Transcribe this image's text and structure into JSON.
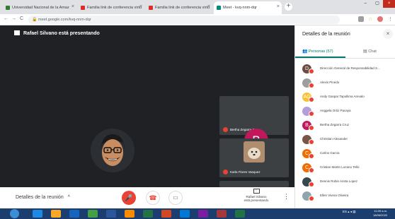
{
  "browser": {
    "tabs": [
      {
        "label": "Universidad Nacional de la Amaz"
      },
      {
        "label": "Familia link de conferencia virtu"
      },
      {
        "label": "Familia link de conferencia virtu"
      },
      {
        "label": "Meet - kvq-nnm-dqr"
      }
    ],
    "new_tab": "+",
    "url": "meet.google.com/kvq-nnm-dqr"
  },
  "meeting": {
    "presenter_banner": "Rafael Silvano está presentando",
    "tiles": [
      {
        "name": "Bertha Zegarra Cruz",
        "avatar_letter": "B",
        "avatar_color": "#c2185b"
      },
      {
        "name": "Karla Flores Vasquez"
      }
    ]
  },
  "controls": {
    "meeting_details": "Detalles de la reunión",
    "chevron": "^",
    "present_label_line1": "Rafael Silvano",
    "present_label_line2": "está presentando",
    "more": "⋮"
  },
  "panel": {
    "title": "Detalles de la reunión",
    "close": "×",
    "tab_people": "Personas (57)",
    "tab_chat": "Chat",
    "people": [
      {
        "name": "Dirección General de Responsabilidad S...",
        "initial": "D",
        "color": "#6d4c41"
      },
      {
        "name": "Alexis Pinedo",
        "initial": "",
        "color": "#9e9e9e"
      },
      {
        "name": "Andy Gaspar Tapullima Arevalo",
        "initial": "AG",
        "color": "#fbc02d"
      },
      {
        "name": "Anggela Ortiz Pacaya",
        "initial": "",
        "color": "#b39ddb"
      },
      {
        "name": "Bertha Zegarra Cruz",
        "initial": "B",
        "color": "#c2185b"
      },
      {
        "name": "Christian Alexander",
        "initial": "",
        "color": "#795548"
      },
      {
        "name": "Carlos Garcia",
        "initial": "C",
        "color": "#ef6c00"
      },
      {
        "name": "Cristian Martin Lozano Tello",
        "initial": "C",
        "color": "#ef6c00"
      },
      {
        "name": "Dennis Robin Arista Lopez",
        "initial": "",
        "color": "#37474f"
      },
      {
        "name": "Ellen Vivera Oliveira",
        "initial": "",
        "color": "#90a4ae"
      }
    ]
  },
  "taskbar": {
    "time": "11:09 a.m.",
    "date": "18/06/2020",
    "tray": "ES ▴ ◂ ▤"
  },
  "colors": {
    "accent": "#00796b",
    "danger": "#ea4335",
    "meet_bg": "#202124",
    "taskbar": "#1c3e6e"
  }
}
